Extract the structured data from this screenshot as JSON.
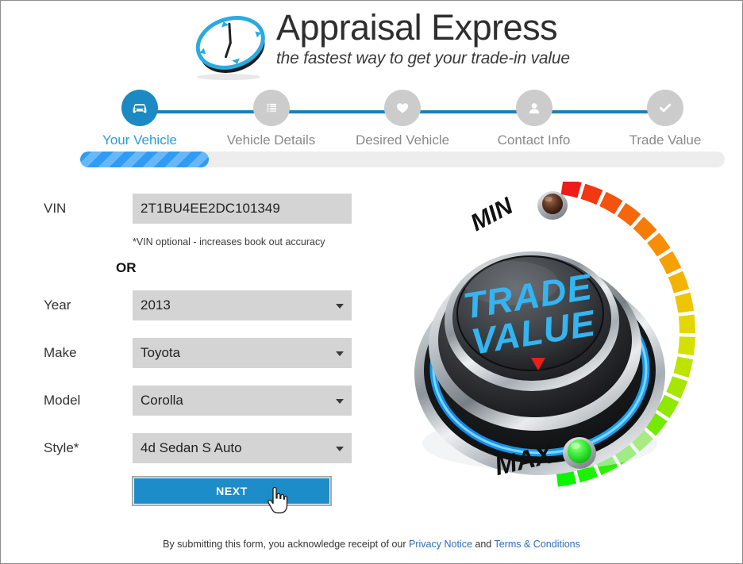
{
  "brand": {
    "name": "Appraisal Express",
    "tagline": "the fastest way to get your trade-in value",
    "logo_icon": "clock-icon",
    "accent_color": "#1b8ac4",
    "logo_accent_color": "#29abe2"
  },
  "stepper": {
    "active_index": 0,
    "line_color": "#1b7fb5",
    "active_color": "#1b8ac4",
    "inactive_color": "#cccccc",
    "steps": [
      {
        "label": "Your Vehicle",
        "icon": "car-icon",
        "active": true
      },
      {
        "label": "Vehicle Details",
        "icon": "list-icon",
        "active": false
      },
      {
        "label": "Desired Vehicle",
        "icon": "heart-icon",
        "active": false
      },
      {
        "label": "Contact Info",
        "icon": "person-icon",
        "active": false
      },
      {
        "label": "Trade Value",
        "icon": "checkmark-icon",
        "active": false
      }
    ]
  },
  "progress": {
    "percent": 20,
    "fill_color": "#2e9cf7",
    "track_color": "#ededed"
  },
  "form": {
    "vin": {
      "label": "VIN",
      "value": "2T1BU4EE2DC101349",
      "placeholder": "",
      "hint": "*VIN optional - increases book out accuracy"
    },
    "or_label": "OR",
    "selects": [
      {
        "label": "Year",
        "value": "2013",
        "icon": "chevron-down-icon"
      },
      {
        "label": "Make",
        "value": "Toyota",
        "icon": "chevron-down-icon"
      },
      {
        "label": "Model",
        "value": "Corolla",
        "icon": "chevron-down-icon"
      },
      {
        "label": "Style*",
        "value": "4d Sedan S Auto",
        "icon": "chevron-down-icon"
      }
    ],
    "next_label": "NEXT"
  },
  "cursor": {
    "icon": "pointing-hand-cursor"
  },
  "footer": {
    "prefix": "By submitting this form, you acknowledge receipt of our",
    "privacy_link": "Privacy Notice",
    "conjunction": "and",
    "terms_link": "Terms & Conditions"
  },
  "dial": {
    "title_line1": "TRADE",
    "title_line2": "VALUE",
    "min_label": "MIN",
    "max_label": "MAX",
    "title_color": "#34b4f0",
    "min_led_color": "#5a2f20",
    "max_led_color": "#2ce52c",
    "scale_colors": [
      "#ee1c16",
      "#f13812",
      "#f4520e",
      "#f5670b",
      "#f67c08",
      "#f78e06",
      "#f5a004",
      "#f2b302",
      "#eec500",
      "#e4d600",
      "#d3e000",
      "#bde400",
      "#a6e600",
      "#8ee800",
      "#74ea00",
      "#5bec00",
      "#44ee00",
      "#2cf000",
      "#19f200",
      "#0cf400"
    ]
  }
}
